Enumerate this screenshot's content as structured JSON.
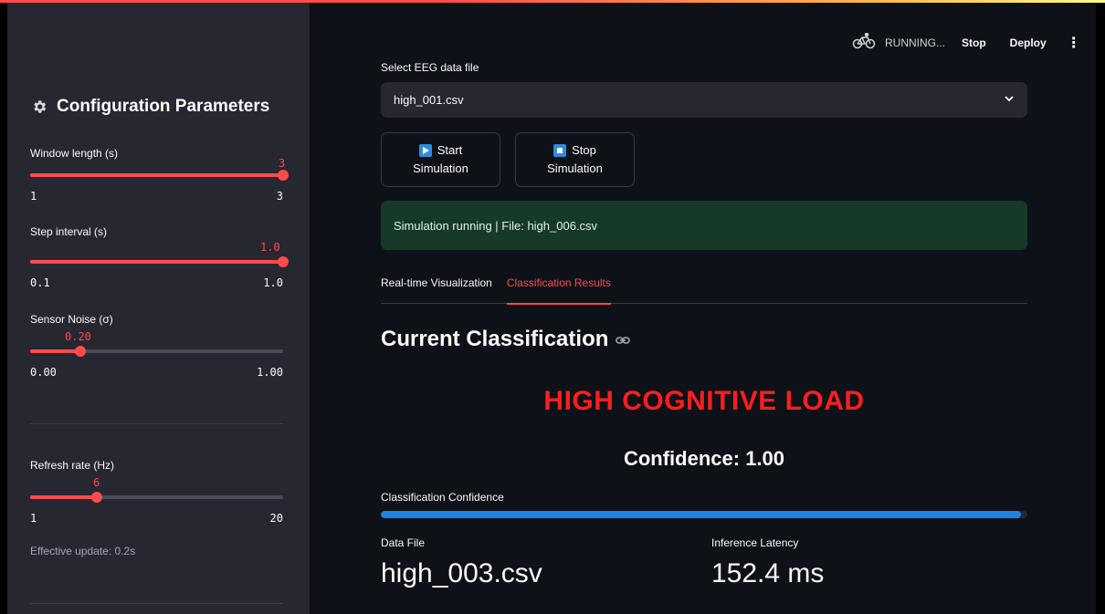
{
  "app": {
    "status": {
      "running_text": "RUNNING...",
      "stop_label": "Stop",
      "deploy_label": "Deploy",
      "menu_glyph": "⋮",
      "icon": "running-bicycle-icon"
    },
    "accent_color": "#ff4b4b"
  },
  "sidebar": {
    "title": "Configuration Parameters",
    "title_icon": "gear-icon",
    "sliders": [
      {
        "label": "Window length (s)",
        "value": "3",
        "min": "1",
        "max": "3",
        "fraction": 1.0
      },
      {
        "label": "Step interval (s)",
        "value": "1.0",
        "min": "0.1",
        "max": "1.0",
        "fraction": 1.0
      },
      {
        "label": "Sensor Noise (σ)",
        "value": "0.20",
        "min": "0.00",
        "max": "1.00",
        "fraction": 0.2
      },
      {
        "label": "Refresh rate (Hz)",
        "value": "6",
        "min": "1",
        "max": "20",
        "fraction": 0.263
      }
    ],
    "caption": "Effective update: 0.2s"
  },
  "main": {
    "file_select": {
      "label": "Select EEG data file",
      "value": "high_001.csv"
    },
    "buttons": {
      "start": {
        "line1": "Start",
        "line2": "Simulation"
      },
      "stop": {
        "line1": "Stop",
        "line2": "Simulation"
      }
    },
    "status_message": "Simulation running | File: high_006.csv",
    "tabs": [
      {
        "label": "Real-time Visualization",
        "active": false
      },
      {
        "label": "Classification Results",
        "active": true
      }
    ],
    "section_title": "Current Classification",
    "classification": "HIGH COGNITIVE LOAD",
    "classification_color": "#ff1e1e",
    "confidence_text": "Confidence: 1.00",
    "progress": {
      "label": "Classification Confidence",
      "value": 0.99,
      "color": "#1c83e1"
    },
    "metrics": [
      {
        "label": "Data File",
        "value": "high_003.csv"
      },
      {
        "label": "Inference Latency",
        "value": "152.4 ms"
      }
    ]
  }
}
